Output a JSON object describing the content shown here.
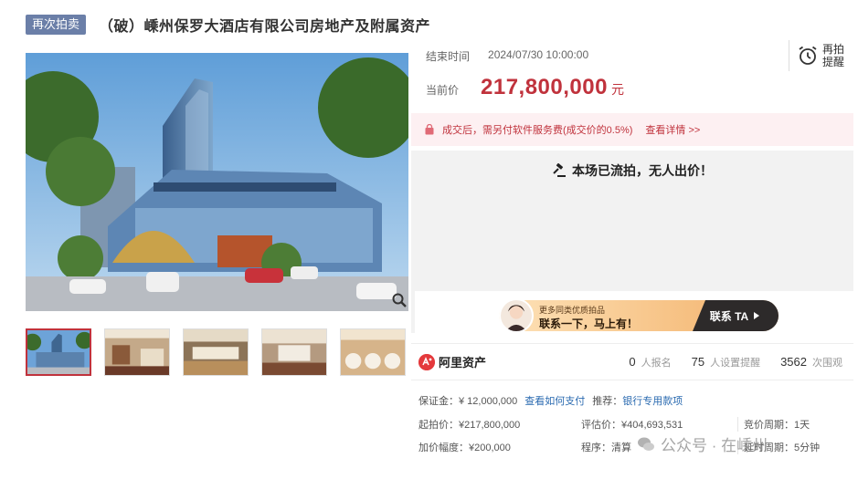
{
  "header": {
    "badge": "再次拍卖",
    "title": "（破）嵊州保罗大酒店有限公司房地产及附属资产"
  },
  "auction": {
    "end_label": "结束时间",
    "end_time": "2024/07/30 10:00:00",
    "price_label": "当前价",
    "price": "217,800,000",
    "price_unit": "元",
    "remind_label": "再拍提醒",
    "fee_text": "成交后，需另付软件服务费(成交价的0.5%)",
    "fee_link": "查看详情 >>",
    "status_text": "本场已流拍，无人出价！"
  },
  "contact": {
    "small_text": "更多同类优质拍品",
    "main_text": "联系一下，马上有！",
    "button": "联系 TA"
  },
  "stats": {
    "brand": "阿里资产",
    "signups_value": "0",
    "signups_label": "人报名",
    "reminders_value": "75",
    "reminders_label": "人设置提醒",
    "views_value": "3562",
    "views_label": "次围观"
  },
  "details": {
    "deposit": "保证金：¥ 12,000,000",
    "how_to_pay": "查看如何支付",
    "recommend_label": "推荐：",
    "bank_link": "银行专用款项",
    "start_price": "起拍价：¥217,800,000",
    "appraisal": "评估价：¥404,693,531",
    "cycle": "竞价周期：1天",
    "increment": "加价幅度：¥200,000",
    "procedure": "程序：清算",
    "delay": "延时周期：5分钟"
  },
  "watermark": "公众号 · 在嵊州",
  "colors": {
    "accent": "#c0323c",
    "badge": "#6b7fa8",
    "link": "#2a6ab0"
  }
}
